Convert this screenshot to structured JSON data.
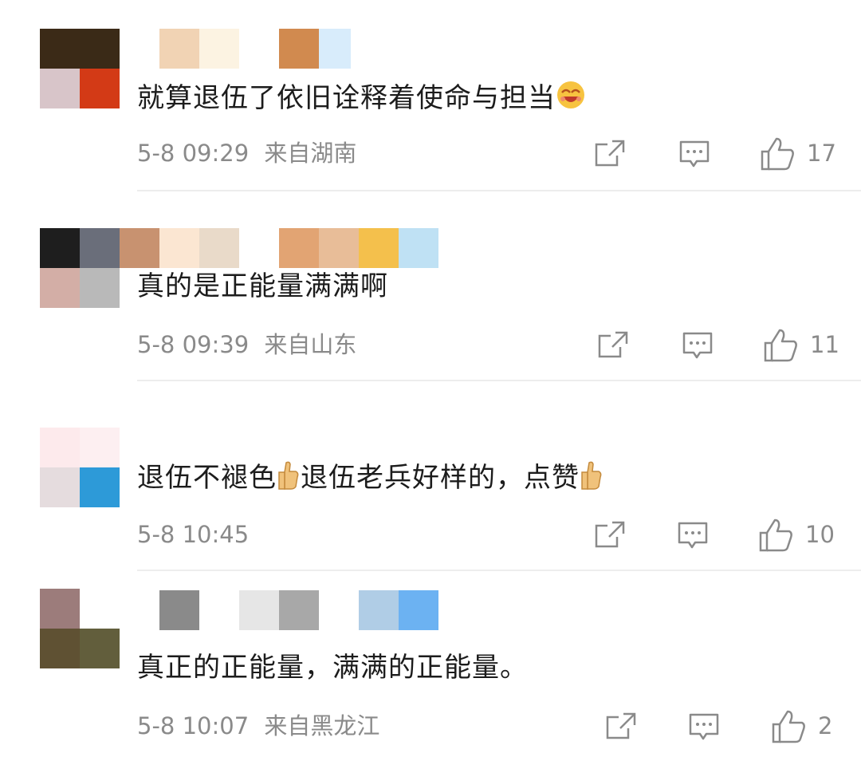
{
  "comments": [
    {
      "text_before": "就算退伍了依旧诠释着使命与担当",
      "emoji": "laughing-face-emoji",
      "time": "5-8 09:29",
      "location": "来自湖南",
      "likes": "17",
      "avatar_colors": [
        "#3b2a17",
        "#3a2a17",
        "#d8c5c9",
        "#d33a16"
      ],
      "name_blur_colors": [
        "#ffffff",
        "#f1d3b4",
        "#fcf3e2",
        "#ffffff",
        "#d18a4f",
        "#8ec6f5"
      ]
    },
    {
      "text": "真的是正能量满满啊",
      "time": "5-8 09:39",
      "location": "来自山东",
      "likes": "11",
      "avatar_colors": [
        "#1e1e1e",
        "#6a6e7a",
        "#d3aea6",
        "#b9b9b9"
      ],
      "name_blur_colors": [
        "#c89270",
        "#fbe6d2",
        "#e9dac9",
        "#ffffff",
        "#e2a473",
        "#e8bd98",
        "#f4c04c",
        "#bfe1f4"
      ]
    },
    {
      "text_part1": "退伍不褪色",
      "text_part2": "退伍老兵好样的，点赞",
      "emoji": "thumbs-up-emoji",
      "time": "5-8 10:45",
      "location": "",
      "likes": "10",
      "avatar_colors": [
        "#fdeaec",
        "#fdeff1",
        "#e5dcde",
        "#2d9ad8"
      ],
      "name_blur_colors": []
    },
    {
      "text": "真正的正能量，满满的正能量。",
      "time": "5-8 10:07",
      "location": "来自黑龙江",
      "likes": "2",
      "avatar_colors": [
        "#9c7c7b",
        "#ffffff",
        "#5f5133",
        "#625e3c"
      ],
      "name_blur_colors": [
        "#8a8a8a",
        "#e6e6e6",
        "#a8a8a8",
        "#ffffff",
        "#b0cde6",
        "#6cb2f2"
      ]
    }
  ],
  "icons": {
    "share": "share-icon",
    "comment": "comment-icon",
    "like": "thumbs-up-icon"
  }
}
